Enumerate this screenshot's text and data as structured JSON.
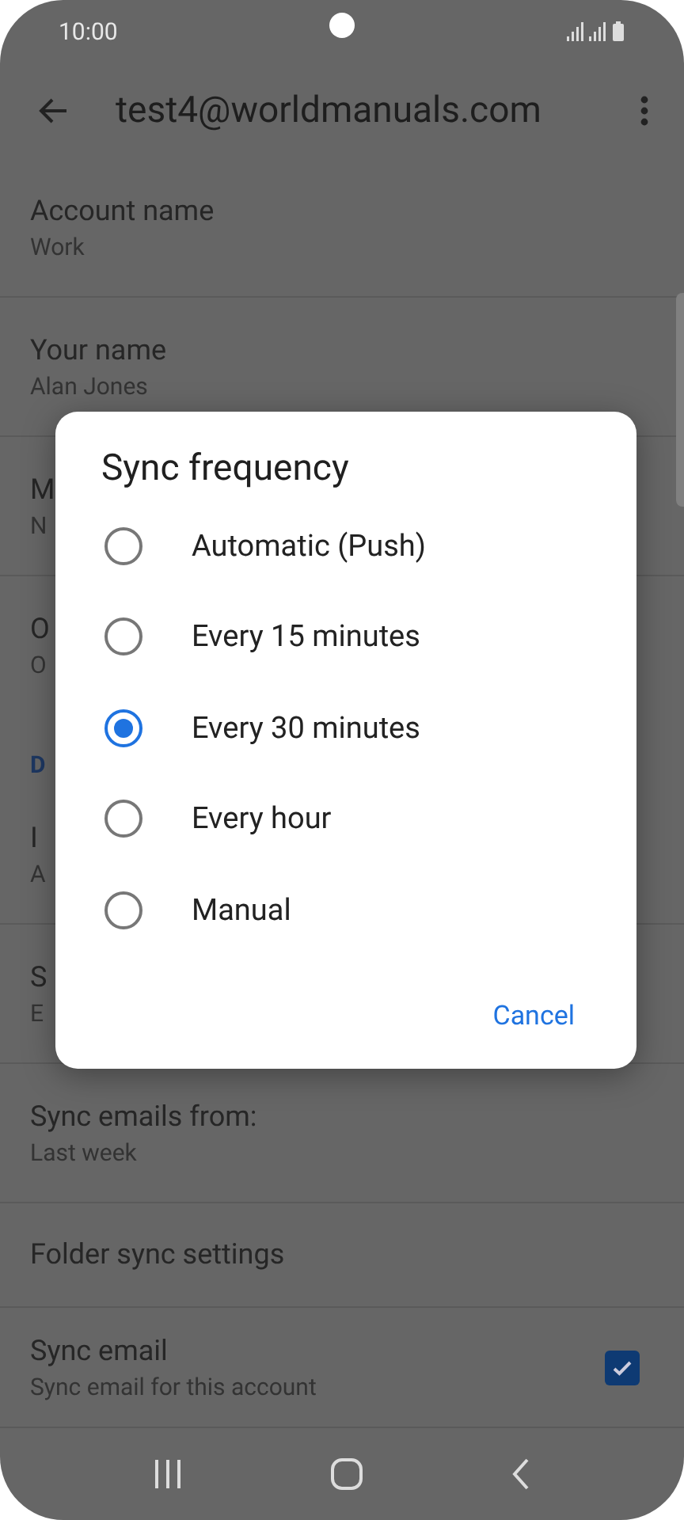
{
  "status_bar": {
    "time": "10:00"
  },
  "header": {
    "title": "test4@worldmanuals.com"
  },
  "settings": [
    {
      "kind": "item",
      "title": "Account name",
      "subtitle": "Work"
    },
    {
      "kind": "item",
      "title": "Your name",
      "subtitle": "Alan Jones"
    },
    {
      "kind": "item",
      "title": "M",
      "subtitle": "N"
    },
    {
      "kind": "item",
      "title": "O",
      "subtitle": "O",
      "divider": false
    },
    {
      "kind": "section",
      "title": "D"
    },
    {
      "kind": "item",
      "title": "I",
      "subtitle": "A"
    },
    {
      "kind": "item",
      "title": "S",
      "subtitle": "E"
    },
    {
      "kind": "item",
      "title": "Sync emails from:",
      "subtitle": "Last week"
    },
    {
      "kind": "single",
      "title": "Folder sync settings"
    },
    {
      "kind": "check",
      "title": "Sync email",
      "subtitle": "Sync email for this account",
      "checked": true
    }
  ],
  "dialog": {
    "title": "Sync frequency",
    "options": [
      {
        "label": "Automatic (Push)",
        "selected": false
      },
      {
        "label": "Every 15 minutes",
        "selected": false
      },
      {
        "label": "Every 30 minutes",
        "selected": true
      },
      {
        "label": "Every hour",
        "selected": false
      },
      {
        "label": "Manual",
        "selected": false
      }
    ],
    "cancel": "Cancel"
  }
}
